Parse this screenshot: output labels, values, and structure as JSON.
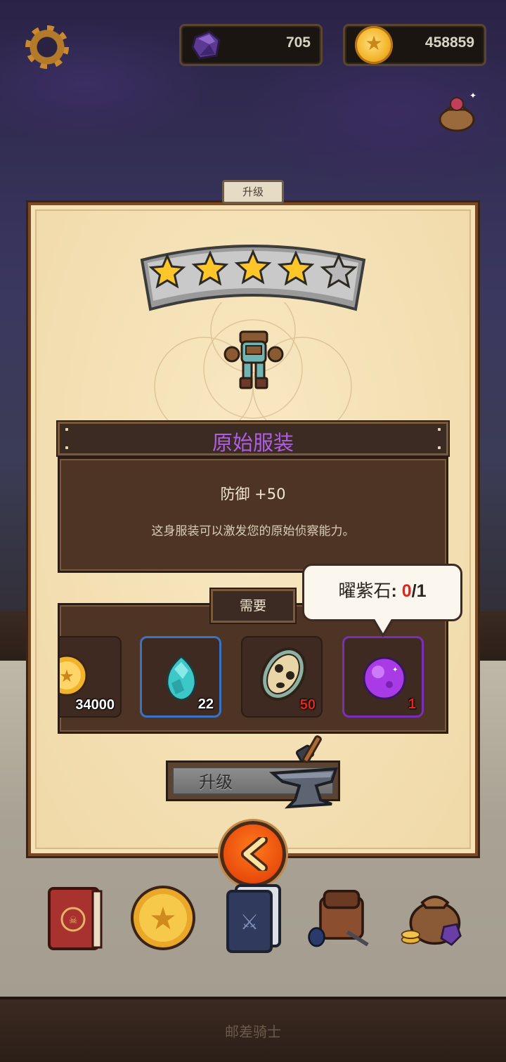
{
  "hud": {
    "gems": "705",
    "gold": "458859"
  },
  "panel": {
    "tab_label": "升级",
    "stars_filled": 4,
    "stars_total": 5,
    "item_name": "原始服装",
    "stat": "防御 +50",
    "description": "这身服装可以激发您的原始侦察能力。",
    "requirements_label": "需要",
    "requirements": [
      {
        "icon": "gold-coin-icon",
        "count": "34000",
        "count_shown": "34000"
      },
      {
        "icon": "cyan-crystal-icon",
        "count": "22"
      },
      {
        "icon": "tribal-mask-icon",
        "count": "50"
      },
      {
        "icon": "purple-orb-icon",
        "count": "1"
      }
    ],
    "tooltip": {
      "name": "曜紫石",
      "sep": ": ",
      "have": "0",
      "need": "/1"
    },
    "upgrade_button": "升级"
  },
  "bottom_nav": [
    "book-icon",
    "gold-star-coin-icon",
    "card-deck-icon",
    "backpack-icon",
    "loot-bag-icon"
  ],
  "footer": "邮差骑士",
  "colors": {
    "item_name": "#b05ee6",
    "missing_count": "#e3261a",
    "back_button": "#e94c0c"
  }
}
